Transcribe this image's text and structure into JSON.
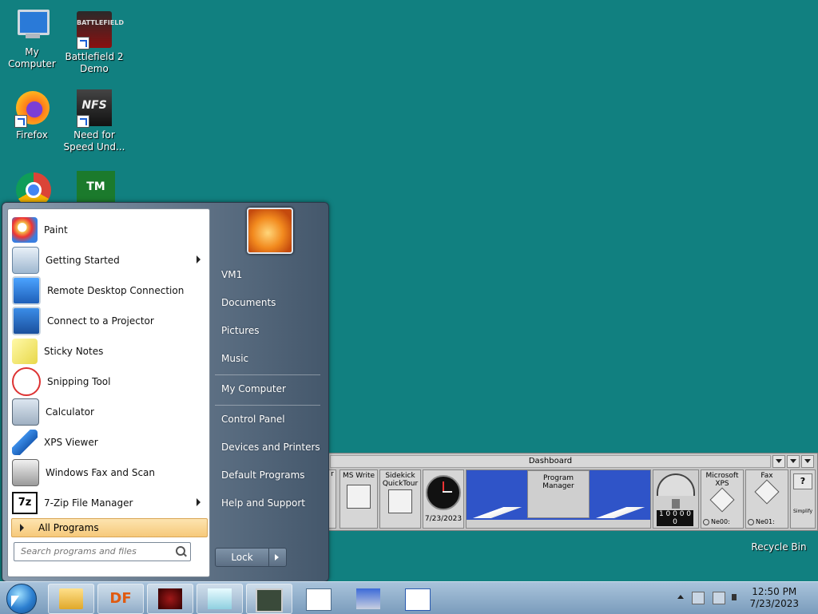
{
  "desktop": {
    "icons": [
      {
        "label": "My Computer",
        "icon": "computer-icon"
      },
      {
        "label": "Battlefield 2 Demo",
        "icon": "battlefield-icon"
      },
      {
        "label": "Firefox",
        "icon": "firefox-icon"
      },
      {
        "label": "Need for Speed Und...",
        "icon": "nfs-icon"
      },
      {
        "label": "",
        "icon": "chrome-icon"
      },
      {
        "label": "",
        "icon": "tm-icon"
      },
      {
        "label": "Recycle Bin",
        "icon": "recycle-bin-icon"
      }
    ]
  },
  "start_menu": {
    "programs": [
      {
        "label": "Paint",
        "submenu": false
      },
      {
        "label": "Getting Started",
        "submenu": true
      },
      {
        "label": "Remote Desktop Connection",
        "submenu": false
      },
      {
        "label": "Connect to a Projector",
        "submenu": false
      },
      {
        "label": "Sticky Notes",
        "submenu": false
      },
      {
        "label": "Snipping Tool",
        "submenu": false
      },
      {
        "label": "Calculator",
        "submenu": false
      },
      {
        "label": "XPS Viewer",
        "submenu": false
      },
      {
        "label": "Windows Fax and Scan",
        "submenu": false
      },
      {
        "label": "7-Zip File Manager",
        "submenu": true
      }
    ],
    "all_programs": "All Programs",
    "search_placeholder": "Search programs and files",
    "right_items": [
      "VM1",
      "Documents",
      "Pictures",
      "Music",
      "My Computer",
      "Control Panel",
      "Devices and Printers",
      "Default Programs",
      "Help and Support"
    ],
    "lock": "Lock"
  },
  "dashboard": {
    "title": "Dashboard",
    "items": [
      "r",
      "MS Write",
      "Sidekick QuickTour",
      "7/23/2023",
      "Program Manager",
      "1 0 0 0 0 0",
      "Microsoft XPS",
      "Fax"
    ],
    "status": [
      "Ne00:",
      "Ne01:"
    ],
    "help": "?",
    "simplify": "Simplify"
  },
  "taskbar": {
    "time": "12:50 PM",
    "date": "7/23/2023",
    "df_label": "DF"
  },
  "colors": {
    "desktop": "#118080",
    "accent": "#f6c97a"
  }
}
